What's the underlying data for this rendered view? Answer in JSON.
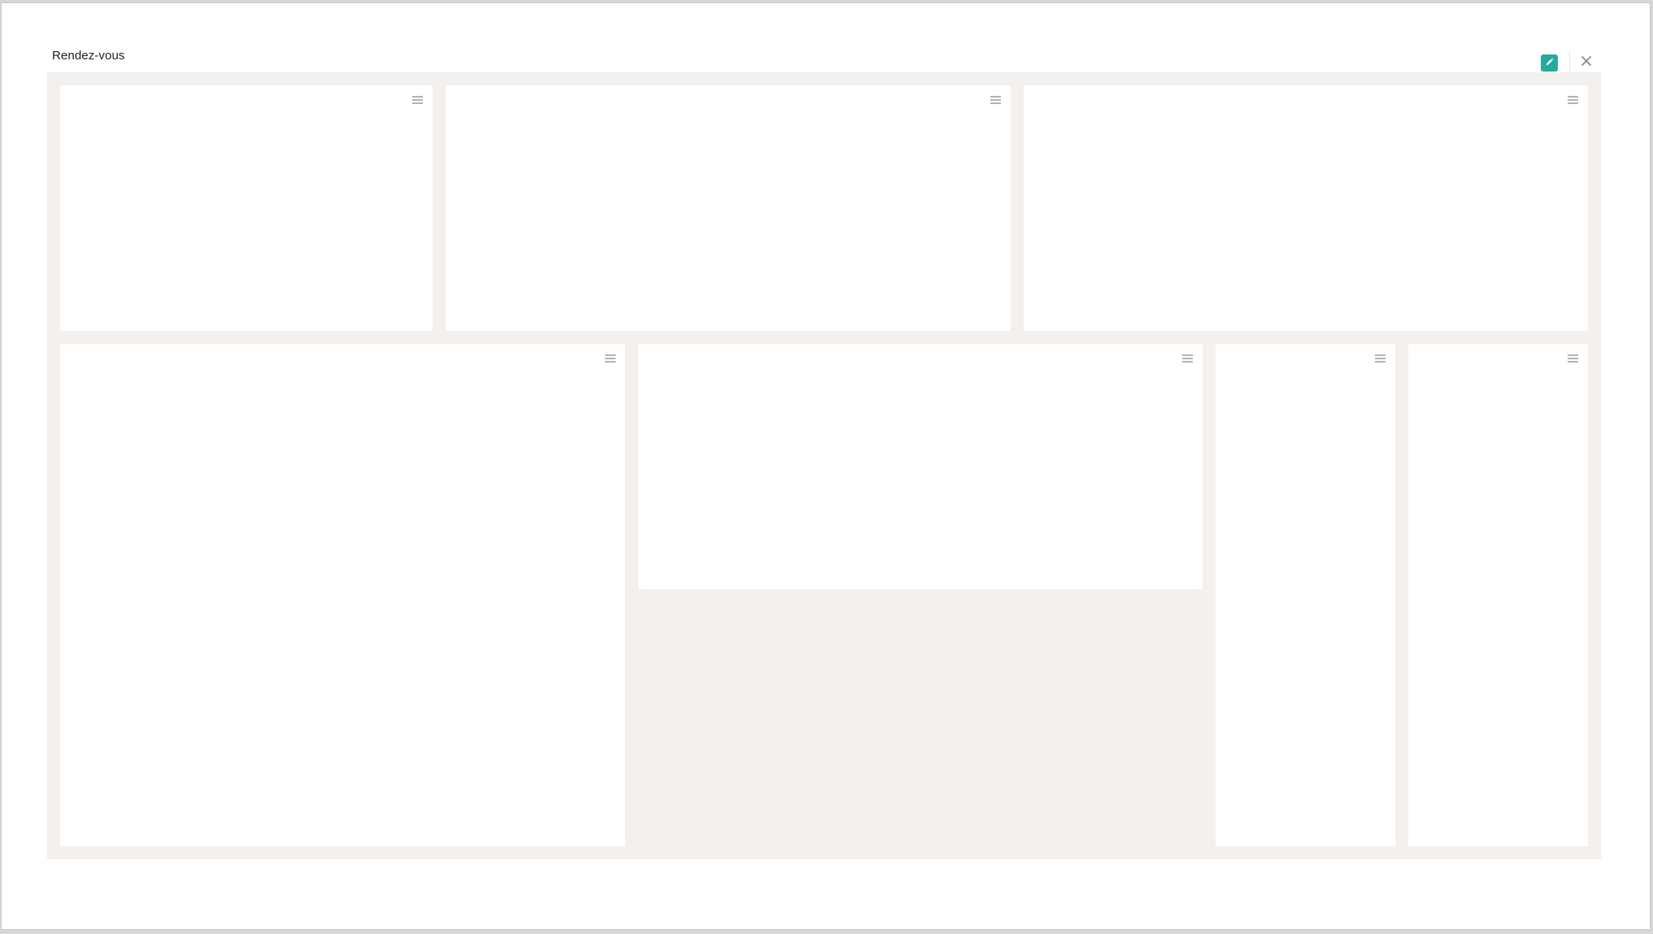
{
  "dialog": {
    "title": "Rendez-vous",
    "edit_icon": "pencil-icon",
    "close_icon": "close-icon"
  },
  "dashboard": {
    "tile_menu_icon": "hamburger-menu-icon",
    "tile_count": 7
  },
  "colors": {
    "accent": "#29a99b",
    "canvas_background": "#f3f0ed",
    "tile_background": "#ffffff",
    "icon_gray": "#9a9a9a"
  }
}
